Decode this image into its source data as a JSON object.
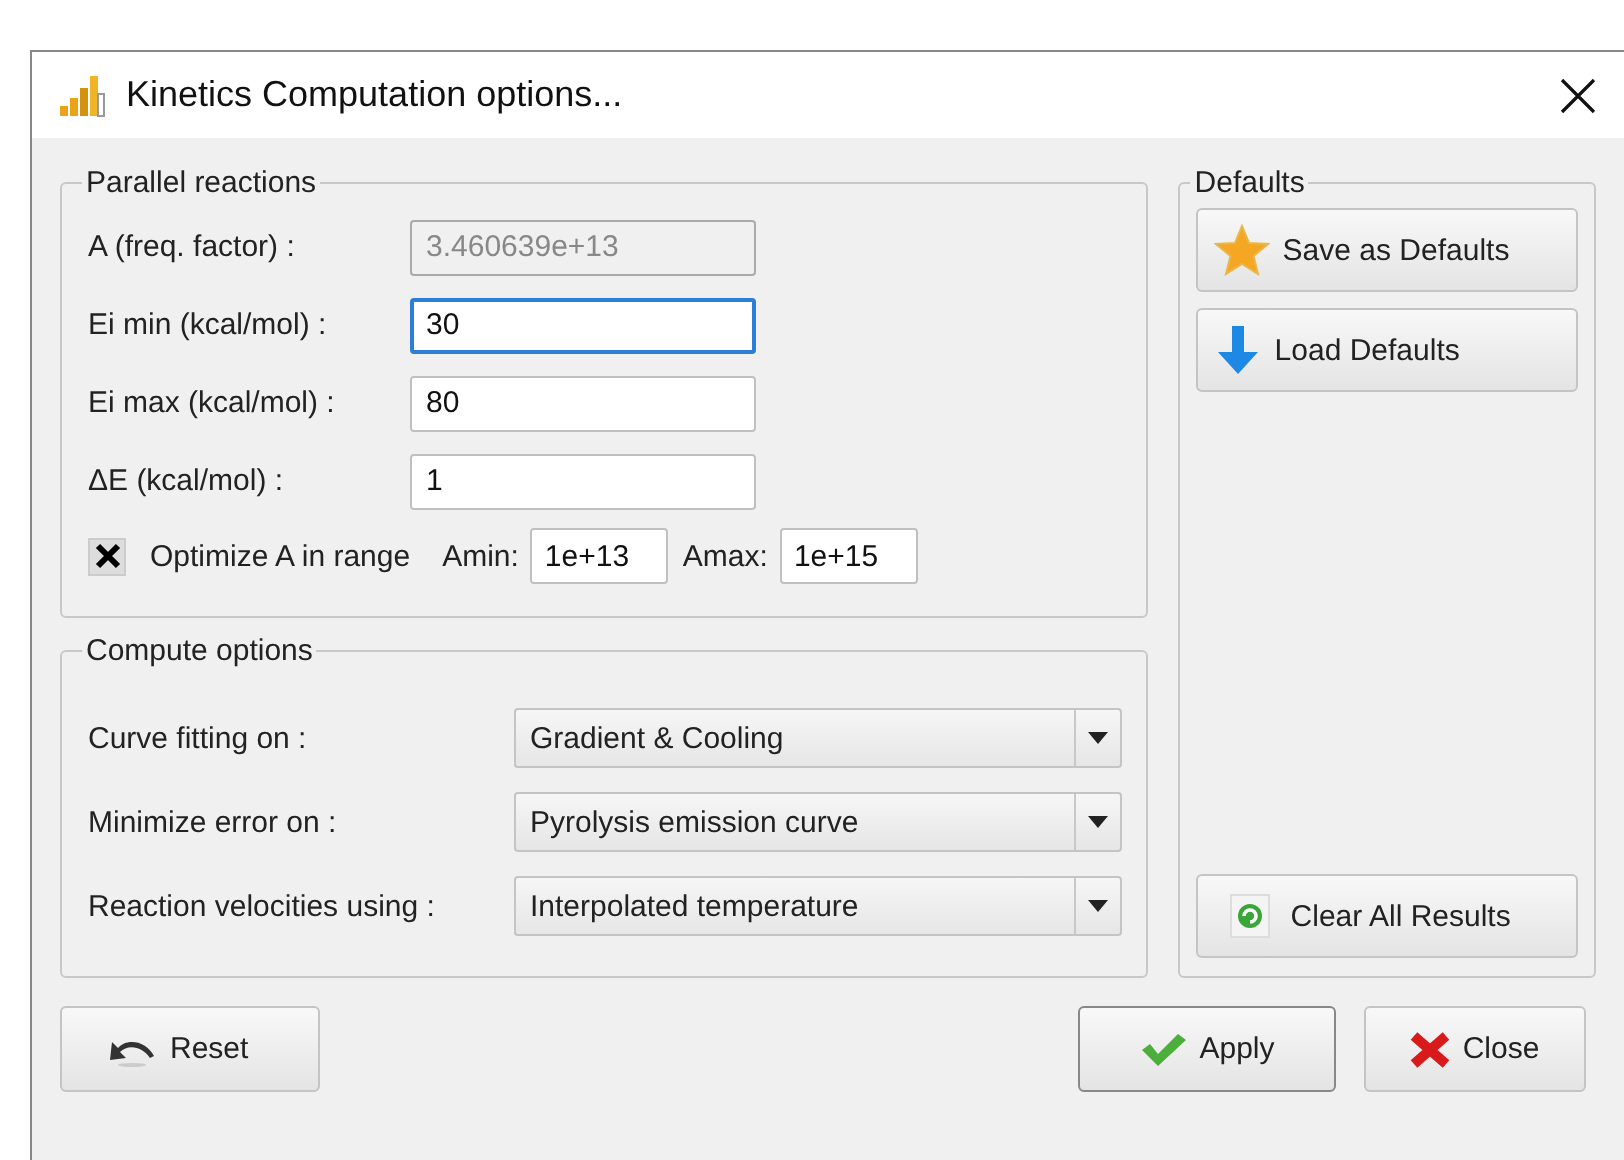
{
  "window": {
    "title": "Kinetics Computation options..."
  },
  "parallel_reactions": {
    "title": "Parallel reactions",
    "fields": [
      {
        "label": "A (freq. factor)  :",
        "value": "3.460639e+13",
        "disabled": true,
        "focused": false
      },
      {
        "label": "Ei min (kcal/mol) :",
        "value": "30",
        "disabled": false,
        "focused": true
      },
      {
        "label": "Ei max (kcal/mol) :",
        "value": "80",
        "disabled": false,
        "focused": false
      },
      {
        "label": "ΔE (kcal/mol) :",
        "value": "1",
        "disabled": false,
        "focused": false
      }
    ],
    "optimize": {
      "label": "Optimize A in range",
      "checked": true,
      "amin_label": "Amin:",
      "amin": "1e+13",
      "amax_label": "Amax:",
      "amax": "1e+15"
    }
  },
  "compute_options": {
    "title": "Compute options",
    "rows": [
      {
        "label": "Curve fitting on :",
        "value": "Gradient & Cooling"
      },
      {
        "label": "Minimize error on :",
        "value": "Pyrolysis emission curve"
      },
      {
        "label": "Reaction velocities using :",
        "value": "Interpolated temperature"
      }
    ]
  },
  "defaults": {
    "title": "Defaults",
    "save": "Save as Defaults",
    "load": "Load Defaults",
    "clear": "Clear All Results"
  },
  "buttons": {
    "reset": "Reset",
    "apply": "Apply",
    "close": "Close"
  }
}
